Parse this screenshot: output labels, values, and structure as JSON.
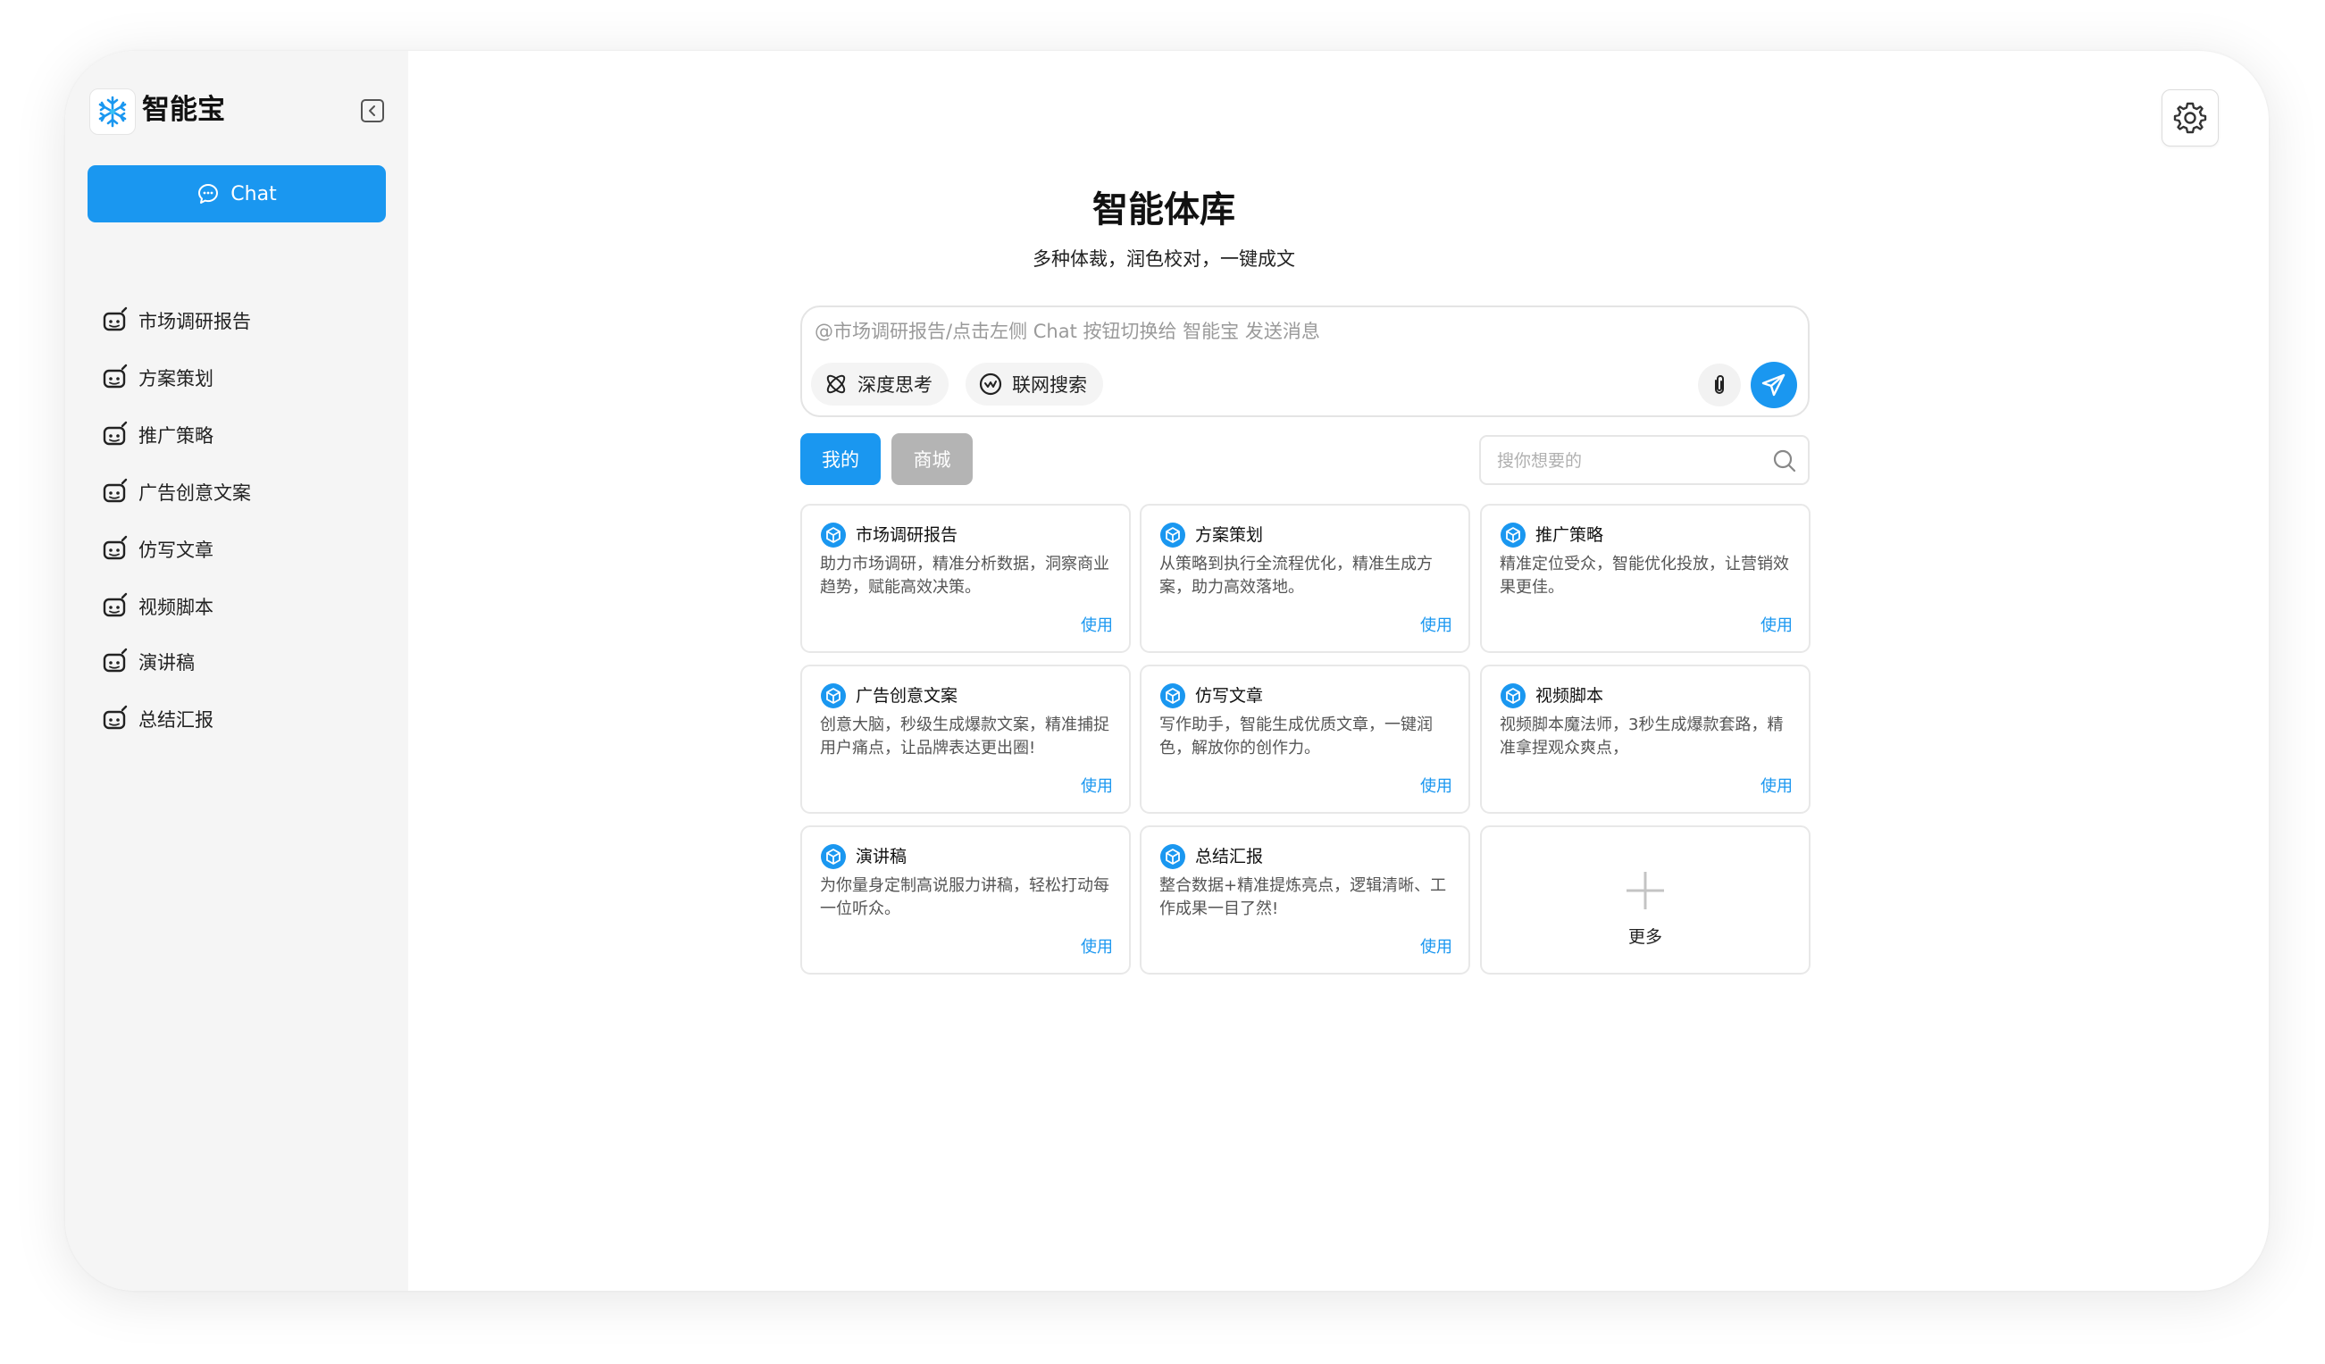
{
  "app": {
    "title": "智能宝",
    "chat_label": "Chat"
  },
  "sidebar": {
    "items": [
      {
        "label": "市场调研报告"
      },
      {
        "label": "方案策划"
      },
      {
        "label": "推广策略"
      },
      {
        "label": "广告创意文案"
      },
      {
        "label": "仿写文章"
      },
      {
        "label": "视频脚本"
      },
      {
        "label": "演讲稿"
      },
      {
        "label": "总结汇报"
      }
    ]
  },
  "main": {
    "title": "智能体库",
    "subtitle": "多种体裁，润色校对，一键成文"
  },
  "composer": {
    "placeholder": "@市场调研报告/点击左侧 Chat 按钮切换给 智能宝 发送消息",
    "deep_think_label": "深度思考",
    "web_search_label": "联网搜索"
  },
  "tabs": {
    "mine": "我的",
    "store": "商城"
  },
  "search": {
    "placeholder": "搜你想要的"
  },
  "cards": [
    {
      "title": "市场调研报告",
      "desc": "助力市场调研，精准分析数据，洞察商业趋势，赋能高效决策。",
      "action": "使用"
    },
    {
      "title": "方案策划",
      "desc": "从策略到执行全流程优化，精准生成方案，助力高效落地。",
      "action": "使用"
    },
    {
      "title": "推广策略",
      "desc": "精准定位受众，智能优化投放，让营销效果更佳。",
      "action": "使用"
    },
    {
      "title": "广告创意文案",
      "desc": "创意大脑，秒级生成爆款文案，精准捕捉用户痛点，让品牌表达更出圈!",
      "action": "使用"
    },
    {
      "title": "仿写文章",
      "desc": "写作助手，智能生成优质文章，一键润色，解放你的创作力。",
      "action": "使用"
    },
    {
      "title": "视频脚本",
      "desc": "视频脚本魔法师，3秒生成爆款套路，精准拿捏观众爽点，",
      "action": "使用"
    },
    {
      "title": "演讲稿",
      "desc": "为你量身定制高说服力讲稿，轻松打动每一位听众。",
      "action": "使用"
    },
    {
      "title": "总结汇报",
      "desc": "整合数据+精准提炼亮点，逻辑清晰、工作成果一目了然!",
      "action": "使用"
    }
  ],
  "more_label": "更多",
  "colors": {
    "accent": "#1a97f0",
    "sidebar_bg": "#f5f5f5",
    "tab_inactive": "#b4b4b4"
  },
  "icons": {
    "logo": "snowflake-icon",
    "collapse": "collapse-sidebar-icon",
    "chat": "chat-bubble-icon",
    "nav": "robot-icon",
    "settings": "gear-icon",
    "deep_think": "atom-icon",
    "web_search": "web-search-icon",
    "attach": "paperclip-icon",
    "send": "send-icon",
    "search": "search-icon",
    "card": "cube-icon",
    "more": "plus-icon"
  }
}
